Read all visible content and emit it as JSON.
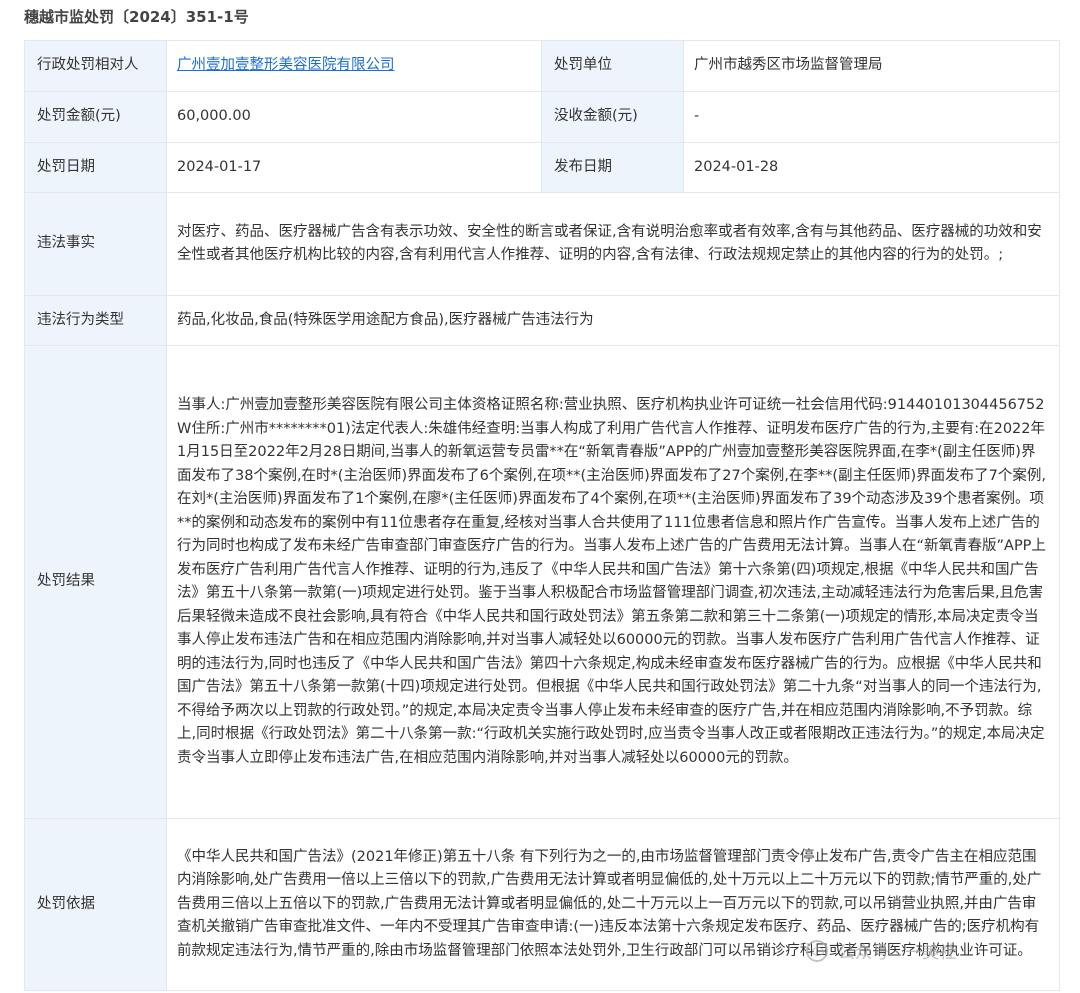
{
  "doc_number": "穗越市监处罚〔2024〕351-1号",
  "row1": {
    "party_label": "行政处罚相对人",
    "party_value": "广州壹加壹整形美容医院有限公司",
    "unit_label": "处罚单位",
    "unit_value": "广州市越秀区市场监督管理局"
  },
  "row2": {
    "amount_label": "处罚金额(元)",
    "amount_value": "60,000.00",
    "confiscation_label": "没收金额(元)",
    "confiscation_value": "-"
  },
  "row3": {
    "penalty_date_label": "处罚日期",
    "penalty_date_value": "2024-01-17",
    "publish_date_label": "发布日期",
    "publish_date_value": "2024-01-28"
  },
  "facts": {
    "label": "违法事实",
    "value": "对医疗、药品、医疗器械广告含有表示功效、安全性的断言或者保证,含有说明治愈率或者有效率,含有与其他药品、医疗器械的功效和安全性或者其他医疗机构比较的内容,含有利用代言人作推荐、证明的内容,含有法律、行政法规规定禁止的其他内容的行为的处罚。;"
  },
  "violation_type": {
    "label": "违法行为类型",
    "value": "药品,化妆品,食品(特殊医学用途配方食品),医疗器械广告违法行为"
  },
  "result": {
    "label": "处罚结果",
    "value": "当事人:广州壹加壹整形美容医院有限公司主体资格证照名称:营业执照、医疗机构执业许可证统一社会信用代码:91440101304456752W住所:广州市********01)法定代表人:朱雄伟经查明:当事人构成了利用广告代言人作推荐、证明发布医疗广告的行为,主要有:在2022年1月15日至2022年2月28日期间,当事人的新氧运营专员雷**在“新氧青春版”APP的广州壹加壹整形美容医院界面,在李*(副主任医师)界面发布了38个案例,在时*(主治医师)界面发布了6个案例,在项**(主治医师)界面发布了27个案例,在李**(副主任医师)界面发布了7个案例,在刘*(主治医师)界面发布了1个案例,在廖*(主任医师)界面发布了4个案例,在项**(主治医师)界面发布了39个动态涉及39个患者案例。项**的案例和动态发布的案例中有11位患者存在重复,经核对当事人合共使用了111位患者信息和照片作广告宣传。当事人发布上述广告的行为同时也构成了发布未经广告审查部门审查医疗广告的行为。当事人发布上述广告的广告费用无法计算。当事人在“新氧青春版”APP上发布医疗广告利用广告代言人作推荐、证明的行为,违反了《中华人民共和国广告法》第十六条第(四)项规定,根据《中华人民共和国广告法》第五十八条第一款第(一)项规定进行处罚。鉴于当事人积极配合市场监督管理部门调查,初次违法,主动减轻违法行为危害后果,且危害后果轻微未造成不良社会影响,具有符合《中华人民共和国行政处罚法》第五条第二款和第三十二条第(一)项规定的情形,本局决定责令当事人停止发布违法广告和在相应范围内消除影响,并对当事人减轻处以60000元的罚款。当事人发布医疗广告利用广告代言人作推荐、证明的违法行为,同时也违反了《中华人民共和国广告法》第四十六条规定,构成未经审查发布医疗器械广告的行为。应根据《中华人民共和国广告法》第五十八条第一款第(十四)项规定进行处罚。但根据《中华人民共和国行政处罚法》第二十九条“对当事人的同一个违法行为,不得给予两次以上罚款的行政处罚。”的规定,本局决定责令当事人停止发布未经审查的医疗广告,并在相应范围内消除影响,不予罚款。综上,同时根据《行政处罚法》第二十八条第一款:“行政机关实施行政处罚时,应当责令当事人改正或者限期改正违法行为。”的规定,本局决定责令当事人立即停止发布违法广告,在相应范围内消除影响,并对当事人减轻处以60000元的罚款。"
  },
  "basis": {
    "label": "处罚依据",
    "value": "《中华人民共和国广告法》(2021年修正)第五十八条 有下列行为之一的,由市场监督管理部门责令停止发布广告,责令广告主在相应范围内消除影响,处广告费用一倍以上三倍以下的罚款,广告费用无法计算或者明显偏低的,处十万元以上二十万元以下的罚款;情节严重的,处广告费用三倍以上五倍以下的罚款,广告费用无法计算或者明显偏低的,处二十万元以上一百万元以下的罚款,可以吊销营业执照,并由广告审查机关撤销广告审查批准文件、一年内不受理其广告审查申请:(一)违反本法第十六条规定发布医疗、药品、医疗器械广告的;医疗机构有前款规定违法行为,情节严重的,除由市场监督管理部门依照本法处罚外,卫生行政部门可以吊销诊疗科目或者吊销医疗机构执业许可证。"
  },
  "watermark": {
    "text": "公众号 · 一美社",
    "icon": "wechat-icon"
  }
}
